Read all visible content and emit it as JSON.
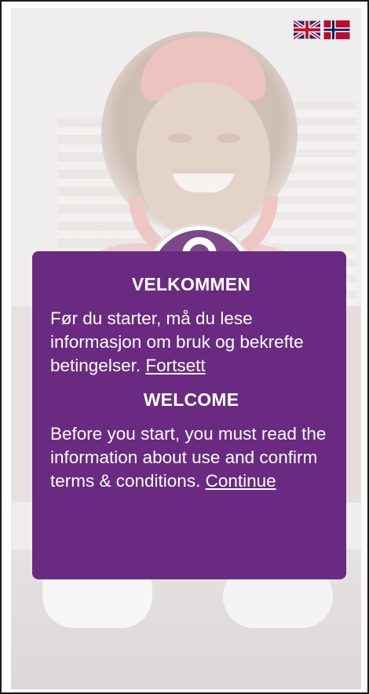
{
  "language_selector": {
    "flags": [
      {
        "icon": "uk-flag-icon",
        "language": "English"
      },
      {
        "icon": "norway-flag-icon",
        "language": "Norwegian"
      }
    ]
  },
  "background": {
    "icon": "lock-icon"
  },
  "dialog": {
    "colors": {
      "background": "#6a2a81",
      "text": "#ffffff"
    },
    "no": {
      "title": "VELKOMMEN",
      "text": "Før du starter, må du lese informasjon om bruk og bekrefte betingelser.",
      "link": "Fortsett"
    },
    "en": {
      "title": "WELCOME",
      "text": "Before you start, you must read the information about use and confirm terms & conditions.",
      "link": "Continue"
    }
  }
}
